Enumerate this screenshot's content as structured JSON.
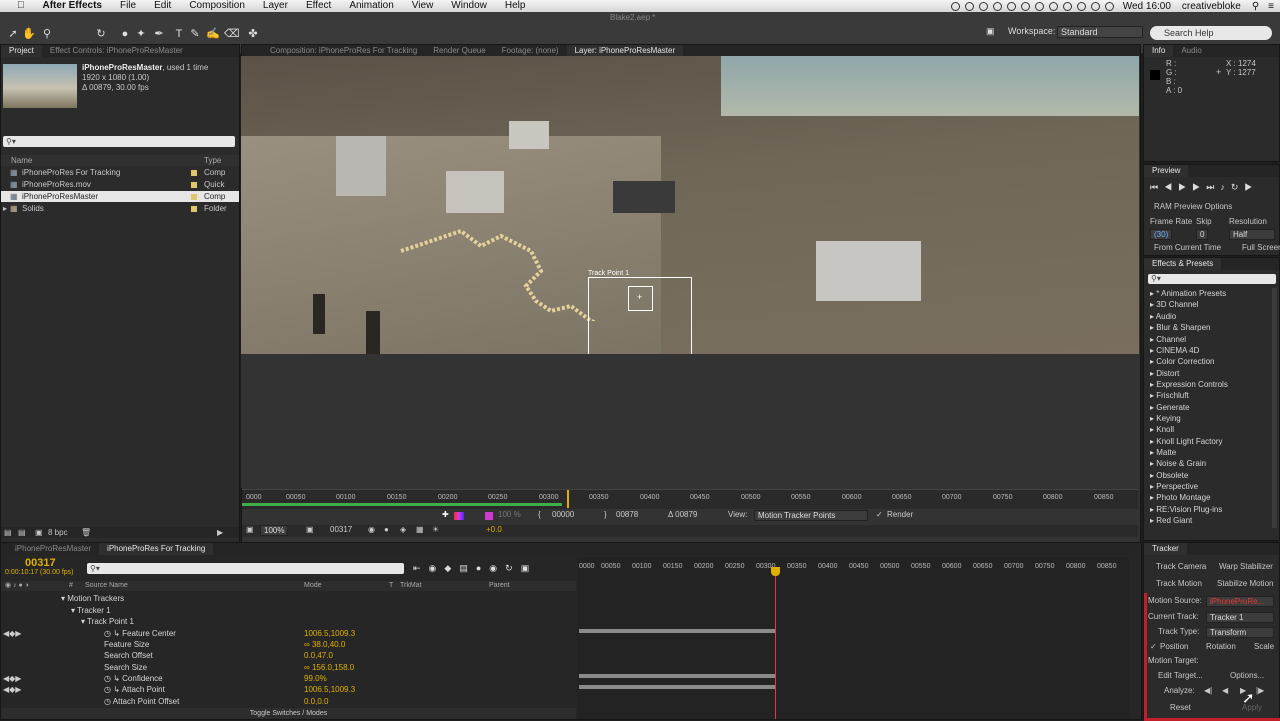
{
  "menubar": {
    "apple": "",
    "app_name": "After Effects",
    "items": [
      "File",
      "Edit",
      "Composition",
      "Layer",
      "Effect",
      "Animation",
      "View",
      "Window",
      "Help"
    ],
    "clock": "Wed 16:00",
    "user": "creativebloke"
  },
  "toolbar": {
    "file_title": "Blake2.aep *",
    "workspace_label": "Workspace:",
    "workspace_value": "Standard",
    "search_placeholder": "Search Help"
  },
  "project": {
    "tabs": [
      "Project",
      "Effect Controls: iPhoneProResMaster"
    ],
    "thumb_name": "iPhoneProResMaster",
    "thumb_used": ", used 1 time",
    "thumb_size": "1920 x 1080 (1.00)",
    "thumb_duration": "Δ 00879, 30.00 fps",
    "col_name": "Name",
    "col_type": "Type",
    "items": [
      {
        "name": "iPhoneProRes For Tracking",
        "type": "Comp"
      },
      {
        "name": "iPhoneProRes.mov",
        "type": "Quick"
      },
      {
        "name": "iPhoneProResMaster",
        "type": "Comp"
      },
      {
        "name": "Solids",
        "type": "Folder"
      }
    ],
    "bpc": "8 bpc"
  },
  "viewer": {
    "tabs": [
      "Composition: iPhoneProRes For Tracking",
      "Render Queue",
      "Footage: (none)",
      "Layer: iPhoneProResMaster"
    ],
    "track_point_label": "Track Point 1",
    "ruler": [
      "0000",
      "00050",
      "00100",
      "00150",
      "00200",
      "00250",
      "00300",
      "00350",
      "00400",
      "00450",
      "00500",
      "00550",
      "00600",
      "00650",
      "00700",
      "00750",
      "00800",
      "00850"
    ],
    "zoom": "100%",
    "frame": "00317",
    "exposure": "100 %",
    "offset": "+0.0",
    "in_point": "00000",
    "out_point": "00878",
    "duration": "Δ 00879",
    "view_label": "View:",
    "view_value": "Motion Tracker Points",
    "render_label": "Render"
  },
  "info": {
    "tabs": [
      "Info",
      "Audio"
    ],
    "r": "R :",
    "g": "G :",
    "b": "B :",
    "a": "A : 0",
    "x": "X : 1274",
    "y": "Y : 1277"
  },
  "preview": {
    "title": "Preview",
    "ram_options": "RAM Preview Options",
    "frame_rate_label": "Frame Rate",
    "skip_label": "Skip",
    "resolution_label": "Resolution",
    "frame_rate": "(30)",
    "skip": "0",
    "resolution": "Half",
    "from_current": "From Current Time",
    "full_screen": "Full Screen"
  },
  "effects": {
    "title": "Effects & Presets",
    "items": [
      "* Animation Presets",
      "3D Channel",
      "Audio",
      "Blur & Sharpen",
      "Channel",
      "CINEMA 4D",
      "Color Correction",
      "Distort",
      "Expression Controls",
      "Frischluft",
      "Generate",
      "Keying",
      "Knoll",
      "Knoll Light Factory",
      "Matte",
      "Noise & Grain",
      "Obsolete",
      "Perspective",
      "Photo Montage",
      "RE:Vision Plug-ins",
      "Red Giant"
    ]
  },
  "timeline": {
    "tabs": [
      "iPhoneProResMaster",
      "iPhoneProRes For Tracking"
    ],
    "timecode": "00317",
    "timecode_sub": "0:00:10:17 (30.00 fps)",
    "col_source": "Source Name",
    "col_mode": "Mode",
    "col_t": "T",
    "col_trkmat": "TrkMat",
    "col_parent": "Parent",
    "rows": [
      {
        "label": "Motion Trackers",
        "value": ""
      },
      {
        "label": "Tracker 1",
        "value": ""
      },
      {
        "label": "Track Point 1",
        "value": ""
      },
      {
        "label": "Feature Center",
        "value": "1006.5,1009.3"
      },
      {
        "label": "Feature Size",
        "value": "38.0,40.0"
      },
      {
        "label": "Search Offset",
        "value": "0.0,47.0"
      },
      {
        "label": "Search Size",
        "value": "156.0,158.0"
      },
      {
        "label": "Confidence",
        "value": "99.0%"
      },
      {
        "label": "Attach Point",
        "value": "1006.5,1009.3"
      },
      {
        "label": "Attach Point Offset",
        "value": "0.0,0.0"
      }
    ],
    "ruler": [
      "0000",
      "00050",
      "00100",
      "00150",
      "00200",
      "00250",
      "00300",
      "00350",
      "00400",
      "00450",
      "00500",
      "00550",
      "00600",
      "00650",
      "00700",
      "00750",
      "00800",
      "00850"
    ],
    "toggle": "Toggle Switches / Modes"
  },
  "tracker": {
    "title": "Tracker",
    "track_camera": "Track Camera",
    "warp_stabilizer": "Warp Stabilizer",
    "track_motion": "Track Motion",
    "stabilize_motion": "Stabilize Motion",
    "motion_source_label": "Motion Source:",
    "motion_source": "iPhoneProRe...",
    "current_track_label": "Current Track:",
    "current_track": "Tracker 1",
    "track_type_label": "Track Type:",
    "track_type": "Transform",
    "position": "Position",
    "rotation": "Rotation",
    "scale": "Scale",
    "motion_target": "Motion Target:",
    "edit_target": "Edit Target...",
    "options": "Options...",
    "analyze": "Analyze:",
    "reset": "Reset",
    "apply": "Apply"
  },
  "colors": {
    "accent_yellow": "#e0b000",
    "playhead_red": "#e53935",
    "highlight_red": "#c21f2a"
  }
}
